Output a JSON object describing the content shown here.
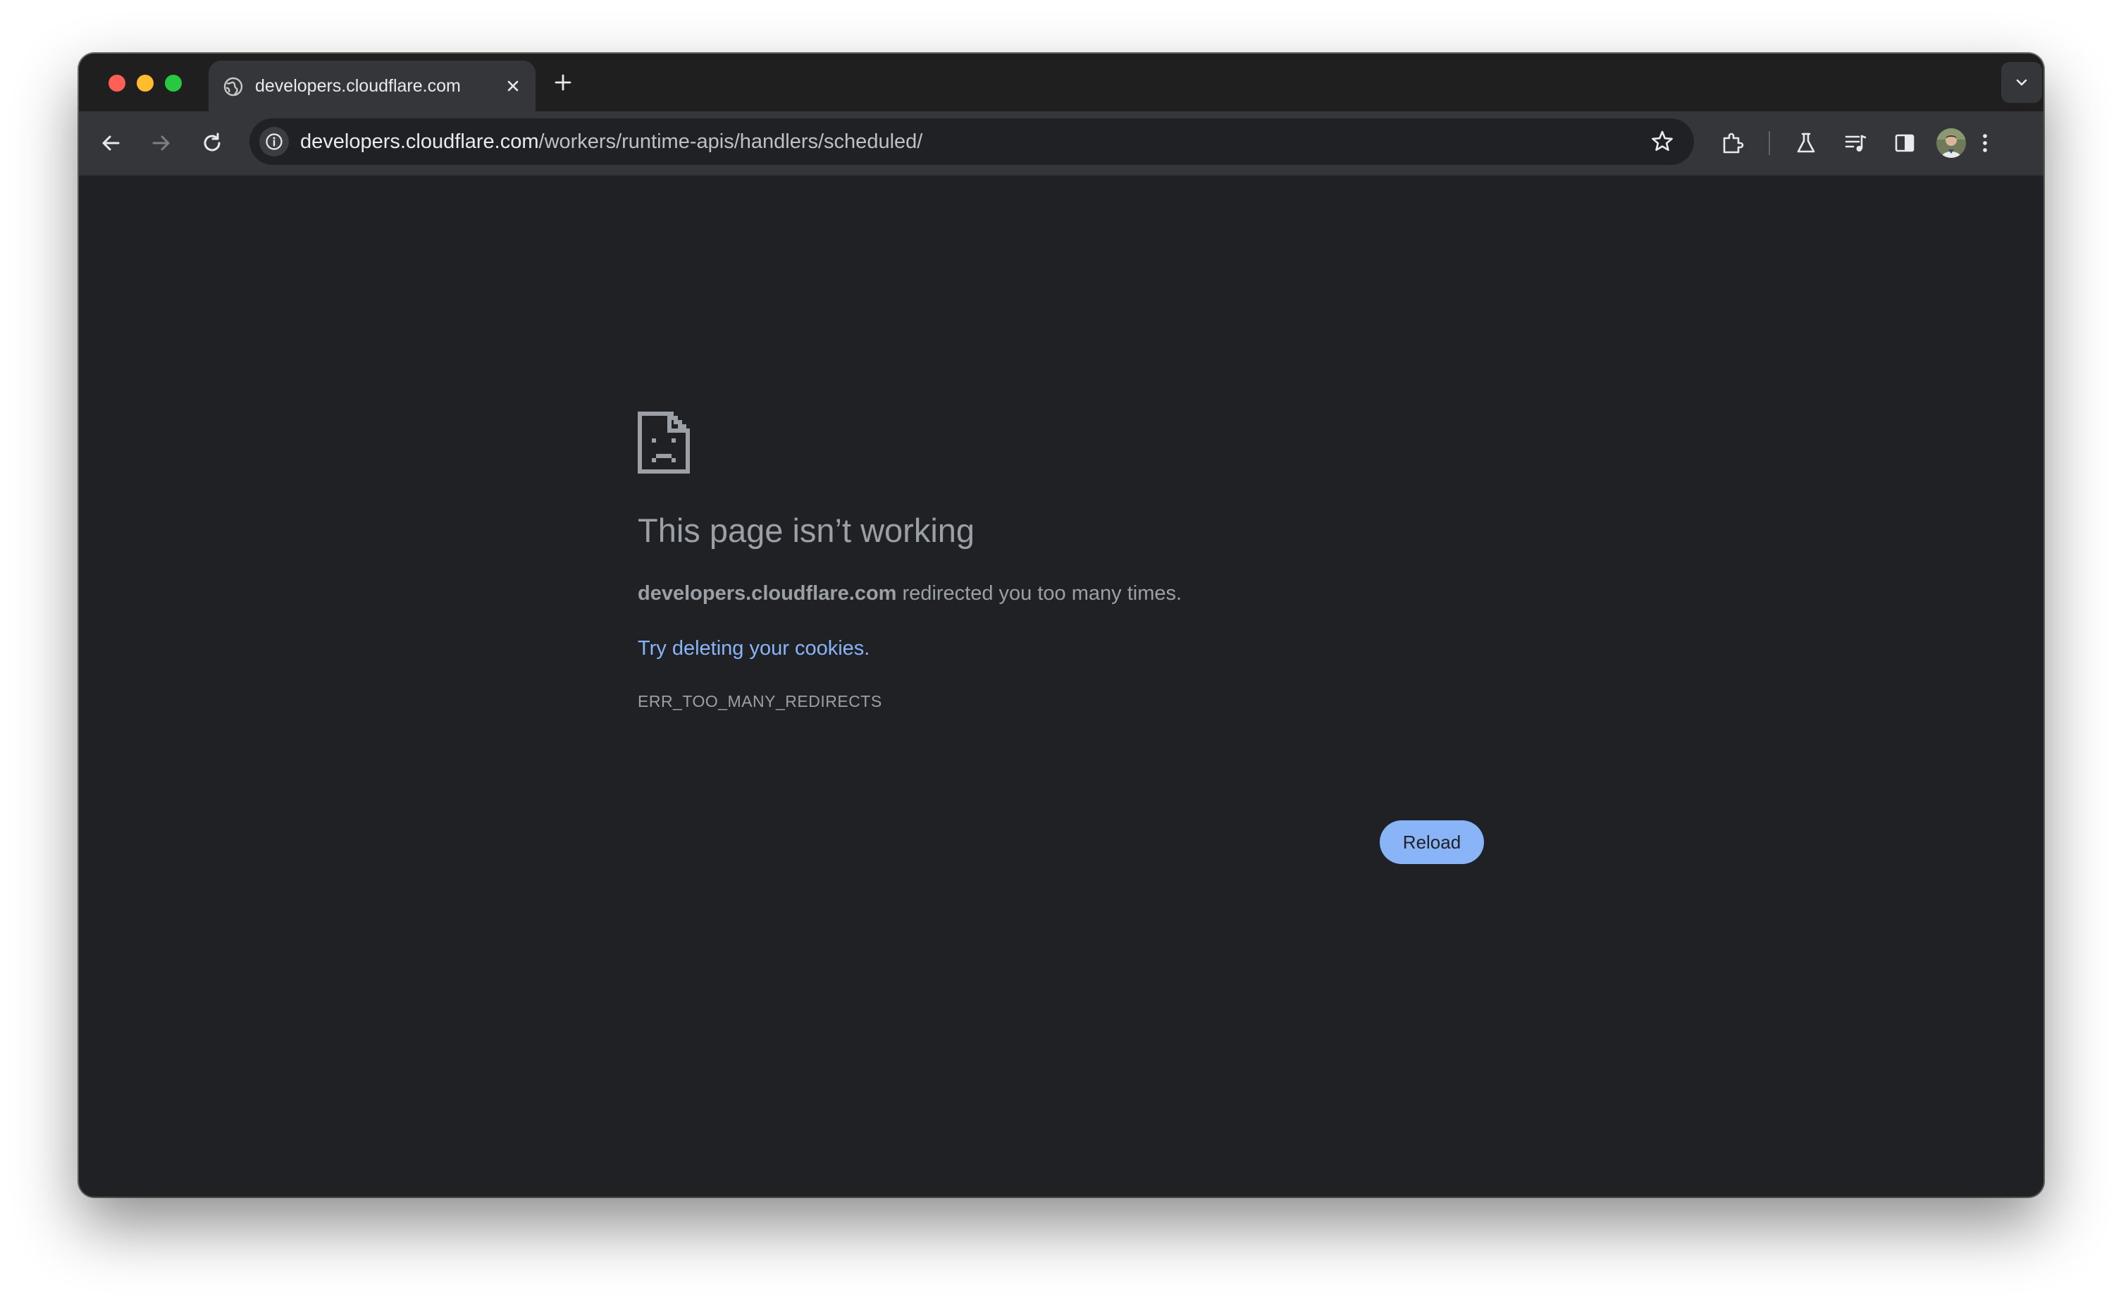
{
  "window": {
    "tab": {
      "title": "developers.cloudflare.com",
      "favicon": "globe-icon"
    },
    "toolbar": {
      "url_host": "developers.cloudflare.com",
      "url_path": "/workers/runtime-apis/handlers/scheduled/",
      "icons": [
        "back-arrow-icon",
        "forward-arrow-icon",
        "reload-icon",
        "site-info-icon",
        "bookmark-star-icon",
        "extensions-icon",
        "labs-flask-icon",
        "media-controls-icon",
        "side-panel-icon",
        "profile-avatar",
        "more-menu-icon"
      ]
    }
  },
  "error_page": {
    "icon": "sad-page-icon",
    "headline": "This page isn’t working",
    "summary_host": "developers.cloudflare.com",
    "summary_rest": " redirected you too many times.",
    "suggestion_link": "Try deleting your cookies",
    "suggestion_end": ".",
    "error_code": "ERR_TOO_MANY_REDIRECTS",
    "reload_label": "Reload"
  },
  "colors": {
    "background": "#202124",
    "toolbar": "#35363a",
    "link": "#8ab4f8",
    "button": "#8ab4f8",
    "text_muted": "#9aa0a6"
  }
}
